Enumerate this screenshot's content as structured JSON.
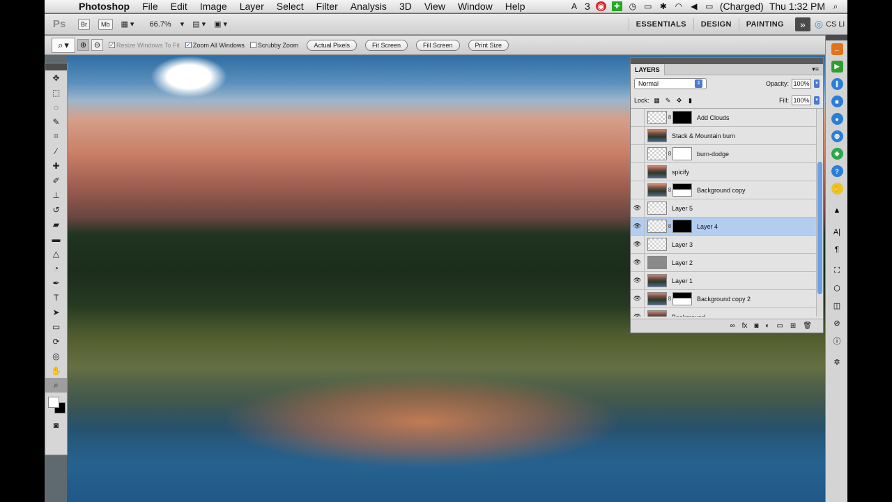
{
  "menubar": {
    "apple": "",
    "app": "Photoshop",
    "items": [
      "File",
      "Edit",
      "Image",
      "Layer",
      "Select",
      "Filter",
      "Analysis",
      "3D",
      "View",
      "Window",
      "Help"
    ],
    "status": {
      "adobe_count": "3",
      "battery": "(Charged)",
      "clock": "Thu 1:32 PM"
    }
  },
  "appbar": {
    "logo": "Ps",
    "bridge": "Br",
    "minibridge": "Mb",
    "zoom": "66.7%",
    "workspaces": [
      "ESSENTIALS",
      "DESIGN",
      "PAINTING"
    ],
    "cslive": "CS Li"
  },
  "options": {
    "resize_windows": "Resize Windows To Fit",
    "zoom_all": "Zoom All Windows",
    "scrubby": "Scrubby Zoom",
    "buttons": [
      "Actual Pixels",
      "Fit Screen",
      "Fill Screen",
      "Print Size"
    ]
  },
  "layers_panel": {
    "tab": "LAYERS",
    "blend_mode": "Normal",
    "opacity_label": "Opacity:",
    "opacity": "100%",
    "lock_label": "Lock:",
    "fill_label": "Fill:",
    "fill": "100%",
    "layers": [
      {
        "name": "Add Clouds",
        "visible": false,
        "thumb": "check",
        "mask": "black"
      },
      {
        "name": "Stack & Mountain burn",
        "visible": false,
        "thumb": "photo",
        "mask": ""
      },
      {
        "name": "burn-dodge",
        "visible": false,
        "thumb": "check",
        "mask": "white"
      },
      {
        "name": "spicify",
        "visible": false,
        "thumb": "photo",
        "mask": ""
      },
      {
        "name": "Background copy",
        "visible": false,
        "thumb": "photo",
        "mask": "mountain"
      },
      {
        "name": "Layer 5",
        "visible": true,
        "thumb": "check",
        "mask": ""
      },
      {
        "name": "Layer 4",
        "visible": true,
        "thumb": "check",
        "mask": "black",
        "selected": true
      },
      {
        "name": "Layer 3",
        "visible": true,
        "thumb": "check",
        "mask": ""
      },
      {
        "name": "Layer 2",
        "visible": true,
        "thumb": "gray",
        "mask": ""
      },
      {
        "name": "Layer 1",
        "visible": true,
        "thumb": "photo",
        "mask": ""
      },
      {
        "name": "Background copy 2",
        "visible": true,
        "thumb": "photo",
        "mask": "mountain"
      },
      {
        "name": "Background",
        "visible": true,
        "thumb": "photo",
        "mask": ""
      }
    ]
  },
  "icons": {
    "eye": "👁",
    "link": "8"
  }
}
